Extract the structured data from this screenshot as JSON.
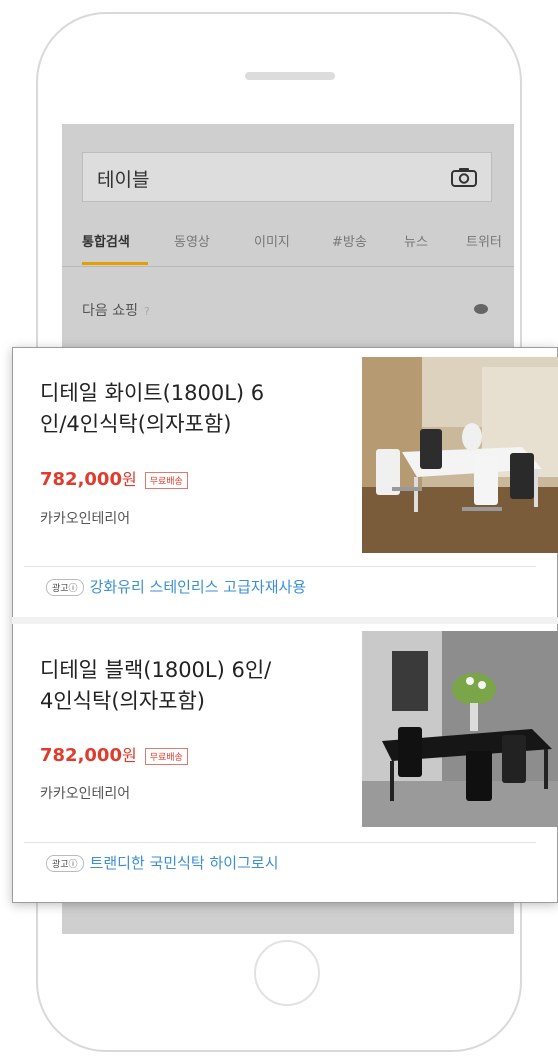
{
  "search": {
    "query": "테이블"
  },
  "tabs": [
    "통합검색",
    "동영상",
    "이미지",
    "#방송",
    "뉴스",
    "트위터"
  ],
  "section": {
    "title": "다음 쇼핑",
    "help": "?"
  },
  "products": [
    {
      "name_line1": "디테일 화이트(1800L) 6",
      "name_line2": "인/4인식탁(의자포함)",
      "price": "782,000",
      "currency": "원",
      "shipping_badge": "무료배송",
      "seller": "카카오인테리어",
      "ad_label": "광고ⓘ",
      "ad_text": "강화유리 스테인리스 고급자재사용"
    },
    {
      "name_line1": "디테일 블랙(1800L) 6인/",
      "name_line2": "4인식탁(의자포함)",
      "price": "782,000",
      "currency": "원",
      "shipping_badge": "무료배송",
      "seller": "카카오인테리어",
      "ad_label": "광고ⓘ",
      "ad_text": "트랜디한 국민식탁 하이그로시"
    }
  ],
  "colors": {
    "price": "#e03c2d",
    "ad_link": "#3b8fd4",
    "tab_underline": "#e2a100"
  }
}
